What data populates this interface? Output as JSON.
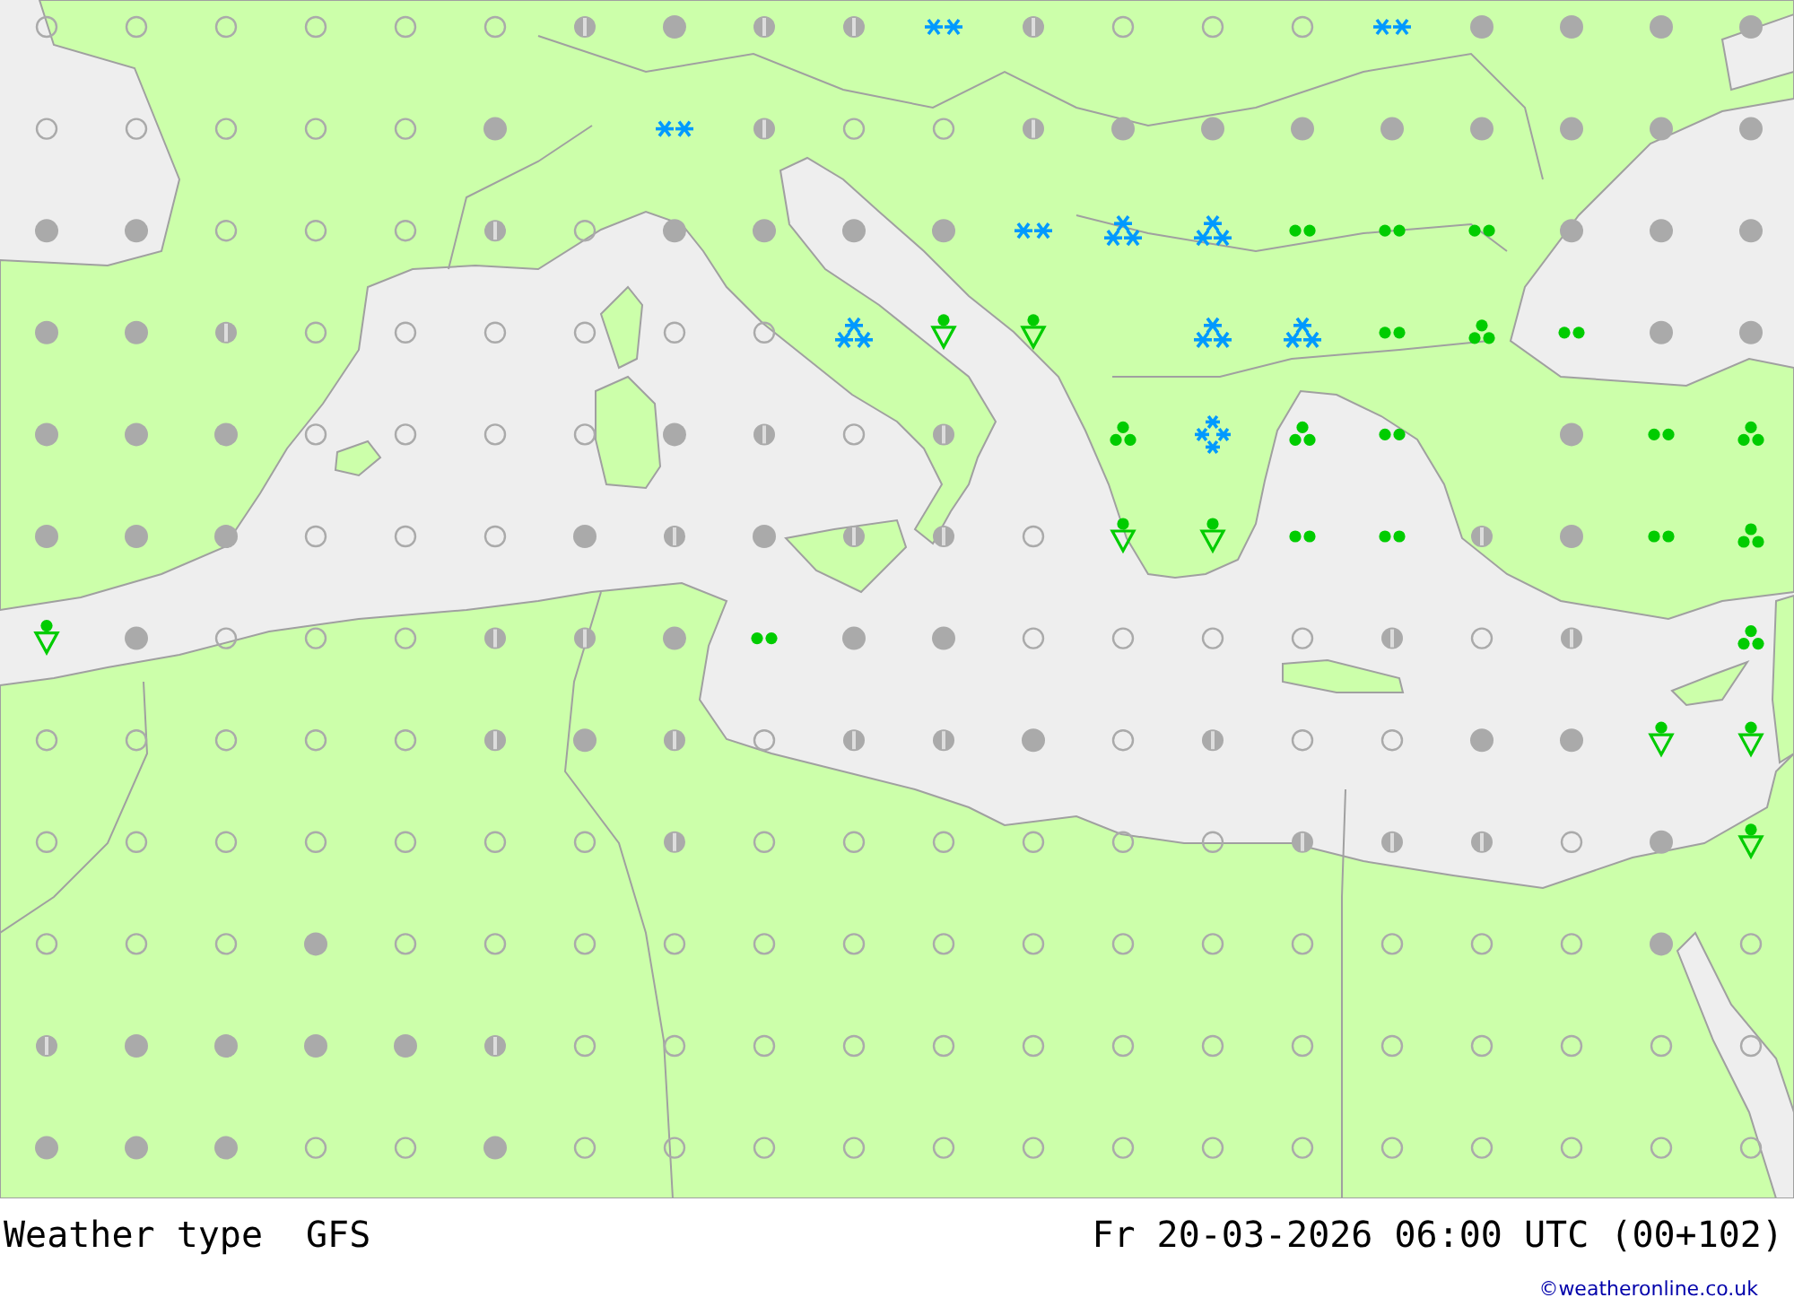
{
  "map": {
    "rows": [
      {
        "cells": [
          {
            "kind": "clear"
          },
          {
            "kind": "clear"
          },
          {
            "kind": "clear"
          },
          {
            "kind": "clear"
          },
          {
            "kind": "clear"
          },
          {
            "kind": "clear"
          },
          {
            "kind": "partly_cloudy"
          },
          {
            "kind": "overcast"
          },
          {
            "kind": "partly_cloudy"
          },
          {
            "kind": "partly_cloudy"
          },
          {
            "kind": "snow"
          },
          {
            "kind": "partly_cloudy"
          },
          {
            "kind": "clear"
          },
          {
            "kind": "clear"
          },
          {
            "kind": "clear"
          },
          {
            "kind": "snow"
          },
          {
            "kind": "overcast"
          },
          {
            "kind": "overcast"
          },
          {
            "kind": "overcast"
          },
          {
            "kind": "overcast"
          }
        ]
      },
      {
        "cells": [
          {
            "kind": "clear"
          },
          {
            "kind": "clear"
          },
          {
            "kind": "clear"
          },
          {
            "kind": "clear"
          },
          {
            "kind": "clear"
          },
          {
            "kind": "overcast"
          },
          {
            "kind": "none"
          },
          {
            "kind": "snow"
          },
          {
            "kind": "partly_cloudy"
          },
          {
            "kind": "clear"
          },
          {
            "kind": "clear"
          },
          {
            "kind": "partly_cloudy"
          },
          {
            "kind": "overcast"
          },
          {
            "kind": "overcast"
          },
          {
            "kind": "overcast"
          },
          {
            "kind": "overcast"
          },
          {
            "kind": "overcast"
          },
          {
            "kind": "overcast"
          },
          {
            "kind": "overcast"
          },
          {
            "kind": "overcast"
          }
        ]
      },
      {
        "cells": [
          {
            "kind": "overcast"
          },
          {
            "kind": "overcast"
          },
          {
            "kind": "clear"
          },
          {
            "kind": "clear"
          },
          {
            "kind": "clear"
          },
          {
            "kind": "partly_cloudy"
          },
          {
            "kind": "clear"
          },
          {
            "kind": "overcast"
          },
          {
            "kind": "overcast"
          },
          {
            "kind": "overcast"
          },
          {
            "kind": "overcast"
          },
          {
            "kind": "snow"
          },
          {
            "kind": "heavy_snow"
          },
          {
            "kind": "heavy_snow"
          },
          {
            "kind": "rain"
          },
          {
            "kind": "rain"
          },
          {
            "kind": "rain"
          },
          {
            "kind": "overcast"
          },
          {
            "kind": "overcast"
          },
          {
            "kind": "overcast"
          }
        ]
      },
      {
        "cells": [
          {
            "kind": "overcast"
          },
          {
            "kind": "overcast"
          },
          {
            "kind": "partly_cloudy"
          },
          {
            "kind": "clear"
          },
          {
            "kind": "clear"
          },
          {
            "kind": "clear"
          },
          {
            "kind": "clear"
          },
          {
            "kind": "clear"
          },
          {
            "kind": "clear"
          },
          {
            "kind": "heavy_snow"
          },
          {
            "kind": "rain_shower"
          },
          {
            "kind": "rain_shower"
          },
          {
            "kind": "none"
          },
          {
            "kind": "heavy_snow"
          },
          {
            "kind": "heavy_snow"
          },
          {
            "kind": "rain"
          },
          {
            "kind": "heavy_rain"
          },
          {
            "kind": "rain"
          },
          {
            "kind": "overcast"
          },
          {
            "kind": "overcast"
          }
        ]
      },
      {
        "cells": [
          {
            "kind": "overcast"
          },
          {
            "kind": "overcast"
          },
          {
            "kind": "overcast"
          },
          {
            "kind": "clear"
          },
          {
            "kind": "clear"
          },
          {
            "kind": "clear"
          },
          {
            "kind": "clear"
          },
          {
            "kind": "overcast"
          },
          {
            "kind": "partly_cloudy"
          },
          {
            "kind": "clear"
          },
          {
            "kind": "partly_cloudy"
          },
          {
            "kind": "none"
          },
          {
            "kind": "heavy_rain"
          },
          {
            "kind": "snowstorm"
          },
          {
            "kind": "heavy_rain"
          },
          {
            "kind": "rain"
          },
          {
            "kind": "none"
          },
          {
            "kind": "overcast"
          },
          {
            "kind": "rain"
          },
          {
            "kind": "heavy_rain"
          }
        ]
      },
      {
        "cells": [
          {
            "kind": "overcast"
          },
          {
            "kind": "overcast"
          },
          {
            "kind": "overcast"
          },
          {
            "kind": "clear"
          },
          {
            "kind": "clear"
          },
          {
            "kind": "clear"
          },
          {
            "kind": "overcast"
          },
          {
            "kind": "partly_cloudy"
          },
          {
            "kind": "overcast"
          },
          {
            "kind": "partly_cloudy"
          },
          {
            "kind": "partly_cloudy"
          },
          {
            "kind": "clear"
          },
          {
            "kind": "rain_shower"
          },
          {
            "kind": "rain_shower"
          },
          {
            "kind": "rain"
          },
          {
            "kind": "rain"
          },
          {
            "kind": "partly_cloudy"
          },
          {
            "kind": "overcast"
          },
          {
            "kind": "rain"
          },
          {
            "kind": "heavy_rain"
          }
        ]
      },
      {
        "cells": [
          {
            "kind": "rain_shower"
          },
          {
            "kind": "overcast"
          },
          {
            "kind": "clear"
          },
          {
            "kind": "clear"
          },
          {
            "kind": "clear"
          },
          {
            "kind": "partly_cloudy"
          },
          {
            "kind": "partly_cloudy"
          },
          {
            "kind": "overcast"
          },
          {
            "kind": "rain"
          },
          {
            "kind": "overcast"
          },
          {
            "kind": "overcast"
          },
          {
            "kind": "clear"
          },
          {
            "kind": "clear"
          },
          {
            "kind": "clear"
          },
          {
            "kind": "clear"
          },
          {
            "kind": "partly_cloudy"
          },
          {
            "kind": "clear"
          },
          {
            "kind": "partly_cloudy"
          },
          {
            "kind": "none"
          },
          {
            "kind": "heavy_rain"
          }
        ]
      },
      {
        "cells": [
          {
            "kind": "clear"
          },
          {
            "kind": "clear"
          },
          {
            "kind": "clear"
          },
          {
            "kind": "clear"
          },
          {
            "kind": "clear"
          },
          {
            "kind": "partly_cloudy"
          },
          {
            "kind": "overcast"
          },
          {
            "kind": "partly_cloudy"
          },
          {
            "kind": "clear"
          },
          {
            "kind": "partly_cloudy"
          },
          {
            "kind": "partly_cloudy"
          },
          {
            "kind": "overcast"
          },
          {
            "kind": "clear"
          },
          {
            "kind": "partly_cloudy"
          },
          {
            "kind": "clear"
          },
          {
            "kind": "clear"
          },
          {
            "kind": "overcast"
          },
          {
            "kind": "overcast"
          },
          {
            "kind": "rain_shower"
          },
          {
            "kind": "rain_shower"
          }
        ]
      },
      {
        "cells": [
          {
            "kind": "clear"
          },
          {
            "kind": "clear"
          },
          {
            "kind": "clear"
          },
          {
            "kind": "clear"
          },
          {
            "kind": "clear"
          },
          {
            "kind": "clear"
          },
          {
            "kind": "clear"
          },
          {
            "kind": "partly_cloudy"
          },
          {
            "kind": "clear"
          },
          {
            "kind": "clear"
          },
          {
            "kind": "clear"
          },
          {
            "kind": "clear"
          },
          {
            "kind": "clear"
          },
          {
            "kind": "clear"
          },
          {
            "kind": "partly_cloudy"
          },
          {
            "kind": "partly_cloudy"
          },
          {
            "kind": "partly_cloudy"
          },
          {
            "kind": "clear"
          },
          {
            "kind": "overcast"
          },
          {
            "kind": "rain_shower"
          }
        ]
      },
      {
        "cells": [
          {
            "kind": "clear"
          },
          {
            "kind": "clear"
          },
          {
            "kind": "clear"
          },
          {
            "kind": "overcast"
          },
          {
            "kind": "clear"
          },
          {
            "kind": "clear"
          },
          {
            "kind": "clear"
          },
          {
            "kind": "clear"
          },
          {
            "kind": "clear"
          },
          {
            "kind": "clear"
          },
          {
            "kind": "clear"
          },
          {
            "kind": "clear"
          },
          {
            "kind": "clear"
          },
          {
            "kind": "clear"
          },
          {
            "kind": "clear"
          },
          {
            "kind": "clear"
          },
          {
            "kind": "clear"
          },
          {
            "kind": "clear"
          },
          {
            "kind": "overcast"
          },
          {
            "kind": "clear"
          }
        ]
      },
      {
        "cells": [
          {
            "kind": "partly_cloudy"
          },
          {
            "kind": "overcast"
          },
          {
            "kind": "overcast"
          },
          {
            "kind": "overcast"
          },
          {
            "kind": "overcast"
          },
          {
            "kind": "partly_cloudy"
          },
          {
            "kind": "clear"
          },
          {
            "kind": "clear"
          },
          {
            "kind": "clear"
          },
          {
            "kind": "clear"
          },
          {
            "kind": "clear"
          },
          {
            "kind": "clear"
          },
          {
            "kind": "clear"
          },
          {
            "kind": "clear"
          },
          {
            "kind": "clear"
          },
          {
            "kind": "clear"
          },
          {
            "kind": "clear"
          },
          {
            "kind": "clear"
          },
          {
            "kind": "clear"
          },
          {
            "kind": "clear"
          }
        ]
      },
      {
        "cells": [
          {
            "kind": "overcast"
          },
          {
            "kind": "overcast"
          },
          {
            "kind": "overcast"
          },
          {
            "kind": "clear"
          },
          {
            "kind": "clear"
          },
          {
            "kind": "overcast"
          },
          {
            "kind": "clear"
          },
          {
            "kind": "clear"
          },
          {
            "kind": "clear"
          },
          {
            "kind": "clear"
          },
          {
            "kind": "clear"
          },
          {
            "kind": "clear"
          },
          {
            "kind": "clear"
          },
          {
            "kind": "clear"
          },
          {
            "kind": "clear"
          },
          {
            "kind": "clear"
          },
          {
            "kind": "clear"
          },
          {
            "kind": "clear"
          },
          {
            "kind": "clear"
          },
          {
            "kind": "clear"
          }
        ]
      }
    ]
  },
  "footer": {
    "title": "Weather type",
    "model": "GFS",
    "valid_time": "Fr 20-03-2026 06:00 UTC (00+102)",
    "credit": "©weatheronline.co.uk"
  }
}
